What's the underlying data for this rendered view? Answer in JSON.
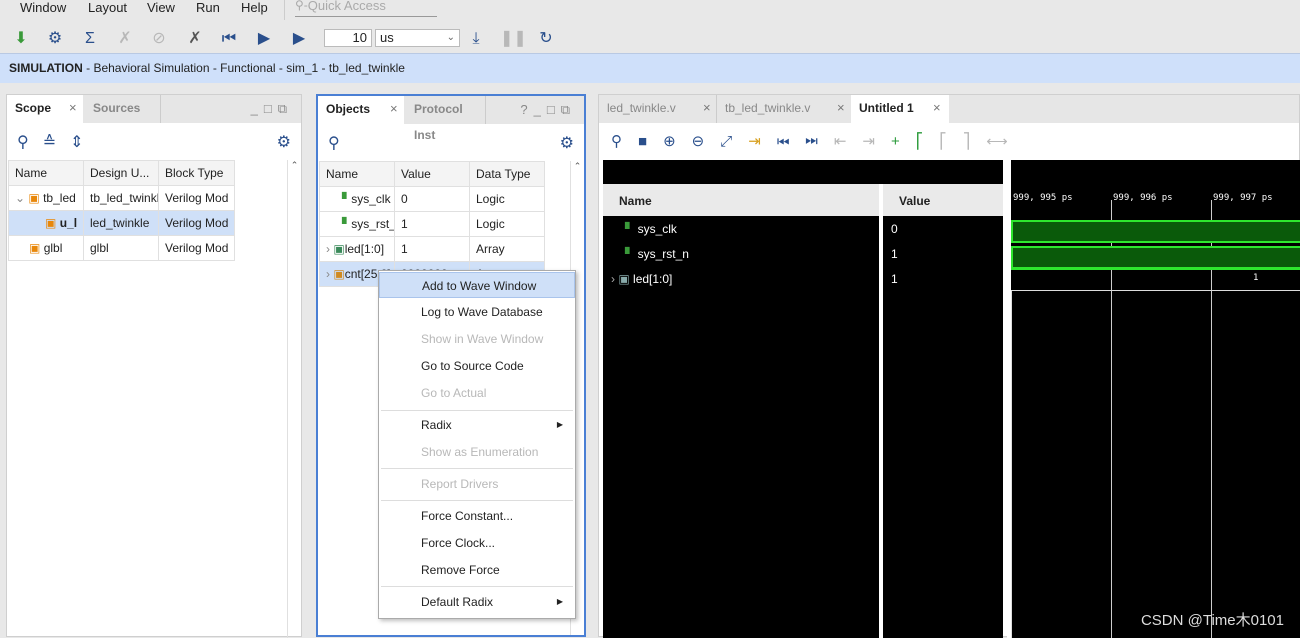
{
  "menu": [
    "Window",
    "Layout",
    "View",
    "Run",
    "Help"
  ],
  "quick_access": "Quick Access",
  "toolbar": {
    "run_time": "10",
    "unit": "us"
  },
  "banner": {
    "bold": "SIMULATION",
    "rest": " - Behavioral Simulation - Functional - sim_1 - tb_led_twinkle"
  },
  "scope": {
    "tabs": [
      "Scope",
      "Sources"
    ],
    "headers": [
      "Name",
      "Design U...",
      "Block Type"
    ],
    "rows": [
      [
        "tb_led",
        "tb_led_twinkle",
        "Verilog Mod"
      ],
      [
        "u_l",
        "led_twinkle",
        "Verilog Mod"
      ],
      [
        "glbl",
        "glbl",
        "Verilog Mod"
      ]
    ]
  },
  "objects": {
    "tabs": [
      "Objects",
      "Protocol Inst"
    ],
    "headers": [
      "Name",
      "Value",
      "Data Type"
    ],
    "rows": [
      [
        "sys_clk",
        "0",
        "Logic"
      ],
      [
        "sys_rst_n",
        "1",
        "Logic"
      ],
      [
        "led[1:0]",
        "1",
        "Array"
      ],
      [
        "cnt[25:0]",
        "0000000",
        "Array"
      ]
    ]
  },
  "context_menu": [
    {
      "label": "Add to Wave Window",
      "enabled": true,
      "highlight": true
    },
    {
      "label": "Log to Wave Database",
      "enabled": true
    },
    {
      "label": "Show in Wave Window",
      "enabled": false
    },
    {
      "label": "Go to Source Code",
      "enabled": true
    },
    {
      "label": "Go to Actual",
      "enabled": false
    },
    {
      "label": "Radix",
      "enabled": true,
      "submenu": true
    },
    {
      "label": "Show as Enumeration",
      "enabled": false
    },
    {
      "label": "Report Drivers",
      "enabled": false
    },
    {
      "label": "Force Constant...",
      "enabled": true
    },
    {
      "label": "Force Clock...",
      "enabled": true
    },
    {
      "label": "Remove Force",
      "enabled": true
    },
    {
      "label": "Default Radix",
      "enabled": true,
      "submenu": true
    }
  ],
  "editor_tabs": [
    "led_twinkle.v",
    "tb_led_twinkle.v",
    "Untitled 1"
  ],
  "wave": {
    "headers": [
      "Name",
      "Value"
    ],
    "signals": [
      {
        "name": "sys_clk",
        "value": "0"
      },
      {
        "name": "sys_rst_n",
        "value": "1"
      },
      {
        "name": "led[1:0]",
        "value": "1"
      }
    ],
    "time_ticks": [
      "999, 995 ps",
      "999, 996 ps",
      "999, 997 ps"
    ],
    "bus_label": "1"
  },
  "watermark": "CSDN @Time木0101"
}
